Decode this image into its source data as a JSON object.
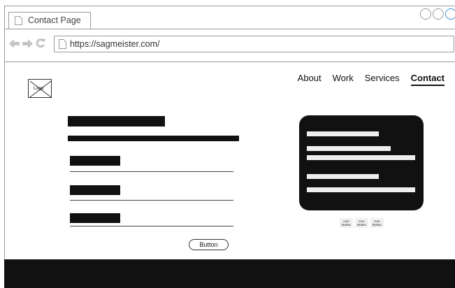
{
  "browser": {
    "tab_title": "Contact Page",
    "url": "https://sagmeister.com/"
  },
  "page": {
    "logo_label": "Logo",
    "nav": [
      {
        "label": "About"
      },
      {
        "label": "Work"
      },
      {
        "label": "Services"
      },
      {
        "label": "Contact",
        "active": true
      }
    ],
    "form_button_label": "Button",
    "icon_buttons": [
      {
        "line1": "Icon",
        "line2": "Button"
      },
      {
        "line1": "Icon",
        "line2": "Button"
      },
      {
        "line1": "Icon",
        "line2": "Button"
      }
    ]
  }
}
